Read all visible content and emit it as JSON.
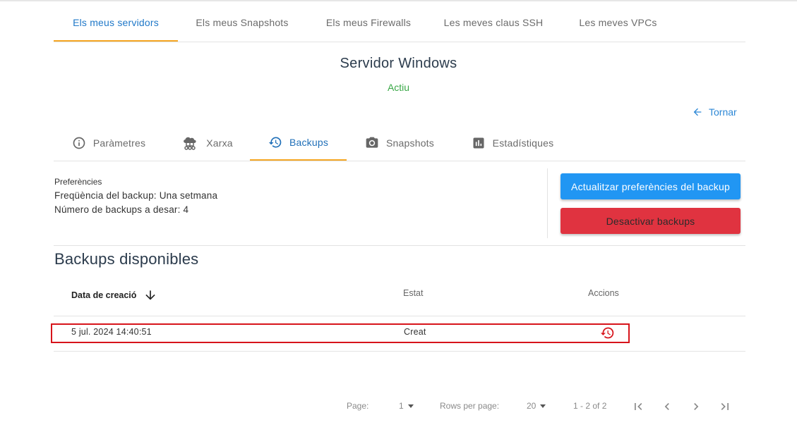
{
  "top_nav": {
    "tabs": [
      {
        "label": "Els meus servidors",
        "active": true
      },
      {
        "label": "Els meus Snapshots",
        "active": false
      },
      {
        "label": "Els meus Firewalls",
        "active": false
      },
      {
        "label": "Les meves claus SSH",
        "active": false
      },
      {
        "label": "Les meves VPCs",
        "active": false
      }
    ]
  },
  "server": {
    "name": "Servidor Windows",
    "status": "Actiu",
    "status_color": "#3aa847"
  },
  "back": {
    "label": "Tornar",
    "icon": "arrow-left-icon"
  },
  "sub_tabs": [
    {
      "label": "Paràmetres",
      "icon": "info-icon",
      "active": false
    },
    {
      "label": "Xarxa",
      "icon": "cloud-network-icon",
      "active": false
    },
    {
      "label": "Backups",
      "icon": "backup-restore-icon",
      "active": true
    },
    {
      "label": "Snapshots",
      "icon": "camera-icon",
      "active": false
    },
    {
      "label": "Estadístiques",
      "icon": "bar-chart-icon",
      "active": false
    }
  ],
  "preferences": {
    "title": "Preferències",
    "frequency": "Freqüència del backup: Una setmana",
    "count": "Número de backups a desar: 4"
  },
  "actions": {
    "update_label": "Actualitzar preferències del backup",
    "update_color": "#2196f3",
    "disable_label": "Desactivar backups",
    "disable_color": "#e03340"
  },
  "backups": {
    "title": "Backups disponibles",
    "columns": {
      "created": "Data de creació",
      "status": "Estat",
      "actions": "Accions"
    },
    "sort": {
      "column": "created",
      "direction": "desc",
      "icon": "arrow-down-icon"
    },
    "rows": [
      {
        "created": "5 jul. 2024 14:40:51",
        "status": "Creat",
        "action_icon": "restore-icon",
        "action_color": "#d7141b",
        "highlighted": true
      }
    ]
  },
  "pagination": {
    "page_label": "Page:",
    "page_value": "1",
    "rows_label": "Rows per page:",
    "rows_value": "20",
    "range": "1 - 2 of 2"
  }
}
